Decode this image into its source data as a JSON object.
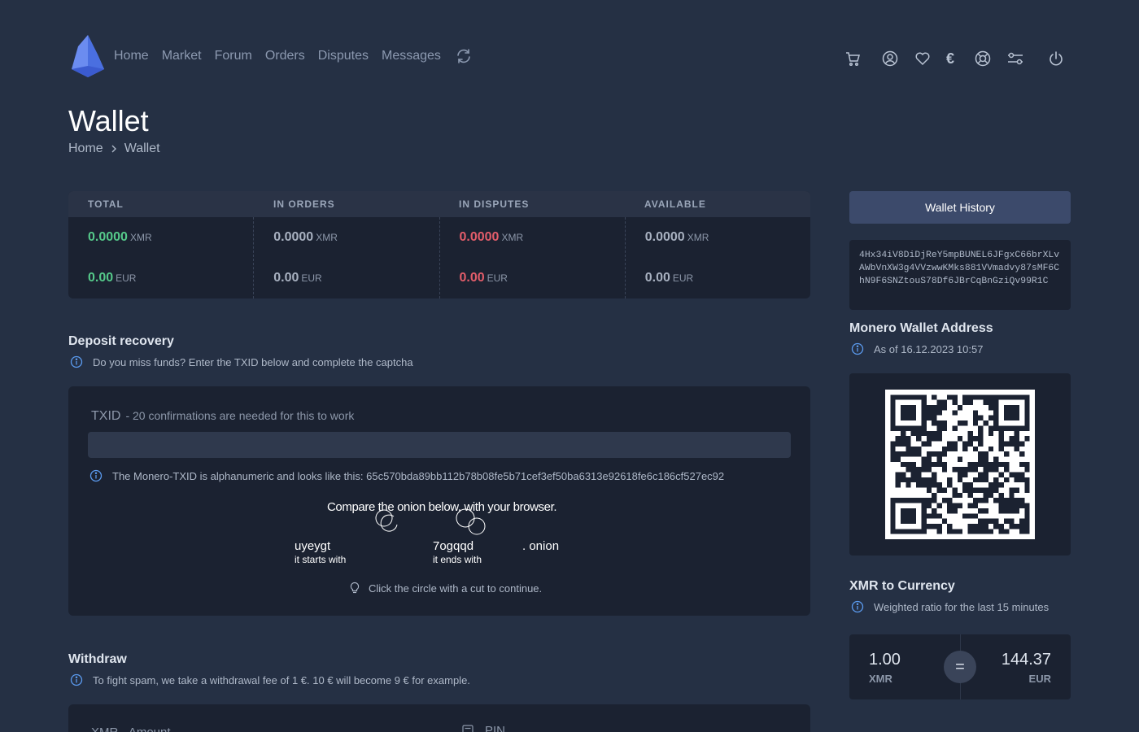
{
  "nav": {
    "links": [
      "Home",
      "Market",
      "Forum",
      "Orders",
      "Disputes",
      "Messages"
    ],
    "currency_symbol": "€",
    "icons": [
      "cart-icon",
      "user-icon",
      "heart-icon",
      "euro-icon",
      "support-icon",
      "settings-icon",
      "power-icon"
    ]
  },
  "page": {
    "title": "Wallet",
    "breadcrumb": [
      "Home",
      "Wallet"
    ]
  },
  "stats": {
    "headers": [
      "TOTAL",
      "IN ORDERS",
      "IN DISPUTES",
      "AVAILABLE"
    ],
    "columns": [
      {
        "xmr": "0.0000",
        "eur": "0.00",
        "color": "#55c98a"
      },
      {
        "xmr": "0.0000",
        "eur": "0.00",
        "color": "#a8b1c0"
      },
      {
        "xmr": "0.0000",
        "eur": "0.00",
        "color": "#e35d6a"
      },
      {
        "xmr": "0.0000",
        "eur": "0.00",
        "color": "#a8b1c0"
      }
    ],
    "unit_xmr": "XMR",
    "unit_eur": "EUR"
  },
  "deposit": {
    "title": "Deposit recovery",
    "note": "Do you miss funds? Enter the TXID below and complete the captcha",
    "txid_label": "TXID",
    "txid_sub": "- 20 confirmations are needed for this to work",
    "txid_value": "",
    "txid_note": "The Monero-TXID is alphanumeric and looks like this: 65c570bda89bb112b78b08fe5b71cef3ef50ba6313e92618fe6c186cf527ec92",
    "captcha": {
      "title": "Compare the onion below, with your browser.",
      "start": "uyeygt",
      "start_label": "it starts with",
      "end": "7ogqqd",
      "end_label": "it ends with",
      "suffix": ". onion"
    },
    "hint": "Click the circle with a cut to continue."
  },
  "withdraw": {
    "title": "Withdraw",
    "note": "To fight spam, we take a withdrawal fee of 1 €. 10 € will become 9 € for example.",
    "amount_label": "XMR - Amount",
    "pin_label": "PIN"
  },
  "sidebar": {
    "history_button": "Wallet History",
    "address": "4Hx34iV8DiDjReY5mpBUNEL6JFgxC66brXLvAWbVnXW3g4VVzwwKMks881VVmadvy87sMF6ChN9F6SNZtouS78Df6JBrCqBnGziQv99R1C",
    "address_title": "Monero Wallet Address",
    "address_date": "As of 16.12.2023 10:57",
    "conv_title": "XMR to Currency",
    "conv_note": "Weighted ratio for the last 15 minutes",
    "conv_left_val": "1.00",
    "conv_left_unit": "XMR",
    "conv_eq": "=",
    "conv_right_val": "144.37",
    "conv_right_unit": "EUR"
  }
}
